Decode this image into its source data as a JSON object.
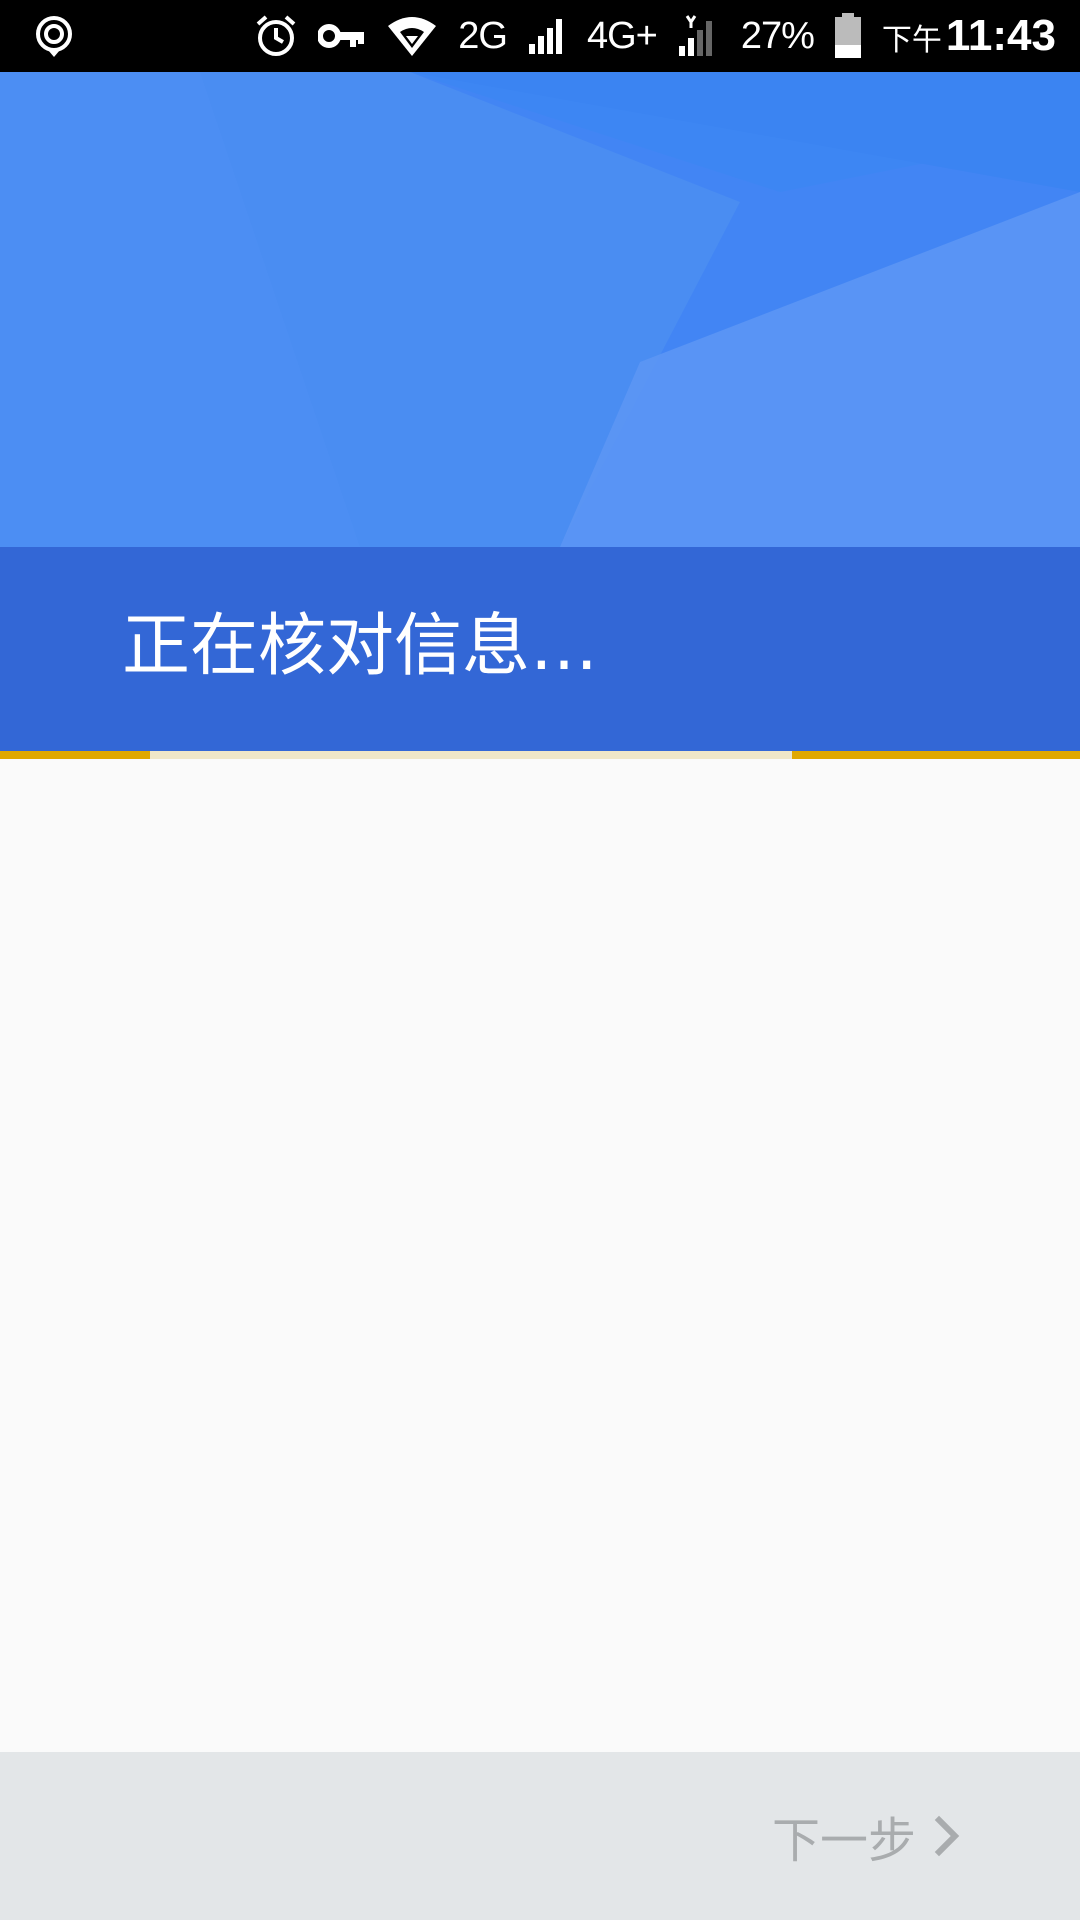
{
  "status_bar": {
    "network_2g": "2G",
    "network_4g": "4G+",
    "battery_percent": "27%",
    "ampm": "下午",
    "time": "11:43",
    "icons": [
      "sync-icon",
      "alarm-icon",
      "vpn-key-icon",
      "wifi-icon",
      "signal-icon",
      "signal-icon",
      "battery-icon"
    ]
  },
  "header": {
    "title": "正在核对信息…",
    "colors": {
      "hero": "#4285f4",
      "band": "#3367d6",
      "progress": "#e0a800"
    }
  },
  "footer": {
    "next_label": "下一步",
    "next_icon": "chevron-right-icon"
  }
}
